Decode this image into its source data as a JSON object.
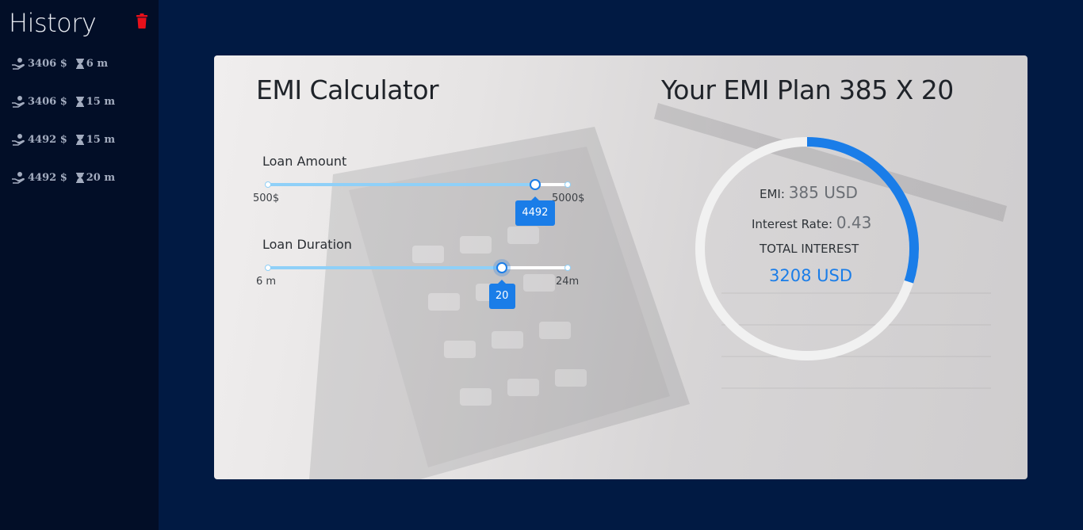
{
  "sidebar": {
    "title": "History",
    "items": [
      {
        "amount": "3406 $",
        "duration": "6 m"
      },
      {
        "amount": "3406 $",
        "duration": "15 m"
      },
      {
        "amount": "4492 $",
        "duration": "15 m"
      },
      {
        "amount": "4492 $",
        "duration": "20 m"
      }
    ],
    "trash_icon": "trash-icon",
    "trash_color": "#e8101a"
  },
  "calculator": {
    "title": "EMI Calculator",
    "loan_amount": {
      "label": "Loan Amount",
      "min_label": "500$",
      "max_label": "5000$",
      "min": 500,
      "max": 5000,
      "value": 4492,
      "value_label": "4492"
    },
    "loan_duration": {
      "label": "Loan Duration",
      "min_label": "6 m",
      "max_label": "24m",
      "min": 6,
      "max": 24,
      "value": 20,
      "value_label": "20"
    }
  },
  "plan": {
    "title": "Your EMI Plan 385 X 20",
    "emi_label": "EMI:",
    "emi_value": "385 USD",
    "rate_label": "Interest Rate:",
    "rate_value": "0.43",
    "total_interest_label": "TOTAL INTEREST",
    "total_interest_value": "3208 USD",
    "progress_fraction": 0.3,
    "accent_color": "#1a7de8"
  }
}
